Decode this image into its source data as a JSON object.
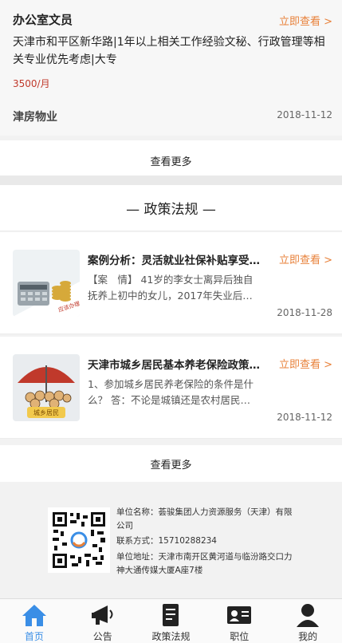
{
  "job": {
    "title": "办公室文员",
    "view_link": "立即查看 >",
    "description": "天津市和平区新华路|1年以上相关工作经验文秘、行政管理等相关专业优先考虑|大专",
    "salary": "3500/月",
    "company": "津房物业",
    "date": "2018-11-12"
  },
  "jobs_more": "查看更多",
  "policy": {
    "section_title": "— 政策法规 —",
    "items": [
      {
        "title": "案例分析：灵活就业社保补贴享受…",
        "view_link": "立即查看 >",
        "excerpt": "【案　情】 41岁的李女士离异后独自抚养上初中的女儿，2017年失业后…",
        "date": "2018-11-28",
        "image_label": "应该办理"
      },
      {
        "title": "天津市城乡居民基本养老保险政策…",
        "view_link": "立即查看 >",
        "excerpt": "1、参加城乡居民养老保险的条件是什么？ 答：不论是城镇还是农村居民…",
        "date": "2018-11-12",
        "image_label": "城乡居民"
      }
    ],
    "more": "查看更多"
  },
  "footer": {
    "company": "单位名称：荟骏集团人力资源服务（天津）有限公司",
    "phone": "联系方式：15710288234",
    "address": "单位地址：天津市南开区黄河道与临汾路交口力神大通传媒大厦A座7楼"
  },
  "tabs": [
    {
      "label": "首页",
      "icon": "home-icon",
      "active": true
    },
    {
      "label": "公告",
      "icon": "megaphone-icon",
      "active": false
    },
    {
      "label": "政策法规",
      "icon": "document-icon",
      "active": false
    },
    {
      "label": "职位",
      "icon": "id-card-icon",
      "active": false
    },
    {
      "label": "我的",
      "icon": "user-icon",
      "active": false
    }
  ],
  "colors": {
    "accent": "#e8813a",
    "salary": "#c0392b",
    "active_tab": "#3a8ee6"
  }
}
